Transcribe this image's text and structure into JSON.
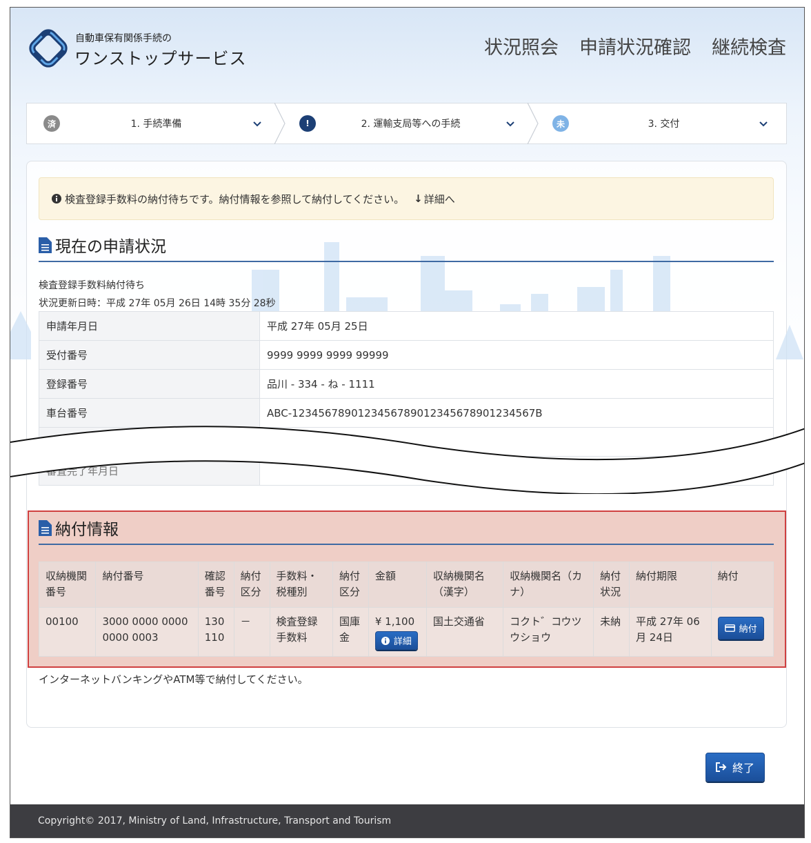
{
  "header": {
    "brand_top": "自動車保有関係手続の",
    "brand_main": "ワンストップサービス",
    "nav": [
      "状況照会",
      "申請状況確認",
      "継続検査"
    ]
  },
  "steps": [
    {
      "badge": "済",
      "label": "1. 手続準備",
      "badge_color": "#8a8a8a"
    },
    {
      "badge": "!",
      "label": "2. 運輸支局等への手続",
      "badge_color": "#1c3f75"
    },
    {
      "badge": "未",
      "label": "3. 交付",
      "badge_color": "#7fb3e6"
    }
  ],
  "alert": {
    "text": "検査登録手数料の納付待ちです。納付情報を参照して納付してください。",
    "link": "詳細へ"
  },
  "status_section": {
    "title": "現在の申請状況",
    "status_line": "検査登録手数料納付待ち",
    "updated": "状況更新日時：平成 27年 05月 26日 14時 35分 28秒",
    "rows": [
      {
        "key": "申請年月日",
        "value": "平成 27年 05月 25日"
      },
      {
        "key": "受付番号",
        "value": "9999 9999 9999 99999"
      },
      {
        "key": "登録番号",
        "value": "品川 - 334 - ね - 1111"
      },
      {
        "key": "車台番号",
        "value": "ABC-1234567890123456789012345678901234567B"
      }
    ],
    "faded_row_key": "審査完了年月日"
  },
  "payment_section": {
    "title": "納付情報",
    "headers": [
      "収納機関番号",
      "納付番号",
      "確認番号",
      "納付区分",
      "手数料・税種別",
      "納付区分",
      "金額",
      "収納機関名（漢字）",
      "収納機関名（カナ）",
      "納付状況",
      "納付期限",
      "納付"
    ],
    "row": {
      "org_no": "00100",
      "pay_no": "3000 0000 0000 0000 0003",
      "confirm_no": "130110",
      "pay_kubun": "－",
      "fee_type": "検査登録手数料",
      "kubun2": "国庫金",
      "amount": "¥ 1,100",
      "detail_btn": "詳細",
      "org_kanji": "国土交通省",
      "org_kana": "コクト゛コウツウショウ",
      "status": "未納",
      "deadline": "平成 27年 06月 24日",
      "pay_btn": "納付"
    },
    "note": "インターネットバンキングやATM等で納付してください。"
  },
  "end_button": "終了",
  "footer": "Copyright© 2017, Ministry of Land, Infrastructure, Transport and Tourism"
}
